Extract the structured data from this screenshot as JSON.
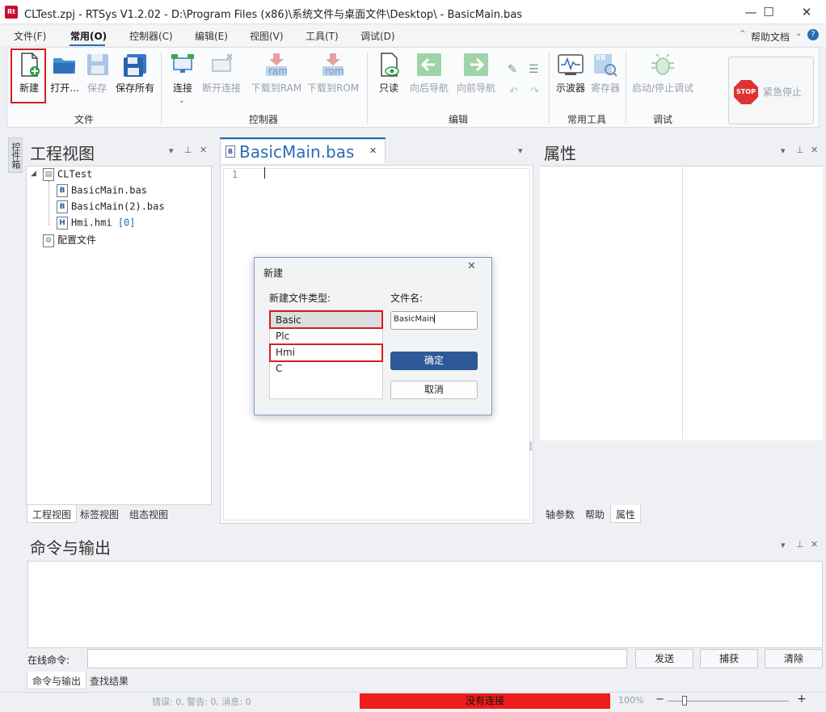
{
  "window": {
    "title": "CLTest.zpj - RTSys V1.2.02 - D:\\Program Files (x86)\\系统文件与桌面文件\\Desktop\\ - BasicMain.bas",
    "app_icon_text": "Rt",
    "minimize": "—",
    "maximize": "☐",
    "close": "✕"
  },
  "menu": {
    "items": [
      "文件(F)",
      "常用(O)",
      "控制器(C)",
      "编辑(E)",
      "视图(V)",
      "工具(T)",
      "调试(D)"
    ],
    "help_label": "帮助文档"
  },
  "ribbon": {
    "groups": [
      "文件",
      "控制器",
      "编辑",
      "常用工具",
      "调试"
    ],
    "buttons": {
      "new": "新建",
      "open": "打开...",
      "save": "保存",
      "save_all": "保存所有",
      "connect": "连接",
      "disconnect": "断开连接",
      "download_ram": "下载到RAM",
      "download_rom": "下载到ROM",
      "readonly": "只读",
      "nav_back": "向后导航",
      "nav_forward": "向前导航",
      "oscilloscope": "示波器",
      "register": "寄存器",
      "start_stop_debug": "启动/停止调试",
      "emergency_stop": "紧急停止"
    },
    "icon_texts": {
      "ram": "ram",
      "rom": "rom",
      "stop": "STOP",
      "vr": "VR"
    }
  },
  "side_tab": "控件箱",
  "project_panel": {
    "title": "工程视图",
    "tree": {
      "root": "CLTest",
      "files": [
        "BasicMain.bas",
        "BasicMain(2).bas",
        "Hmi.hmi"
      ],
      "hmi_badge": "[0]",
      "config": "配置文件"
    },
    "tabs": [
      "工程视图",
      "标签视图",
      "组态视图"
    ]
  },
  "editor": {
    "tab_label": "BasicMain.bas",
    "tab_icon_letter": "B",
    "line_number": "1"
  },
  "properties_panel": {
    "title": "属性",
    "tabs": [
      "轴参数",
      "帮助",
      "属性"
    ]
  },
  "command_panel": {
    "title": "命令与输出",
    "online_label": "在线命令:",
    "buttons": [
      "发送",
      "捕获",
      "清除"
    ],
    "tabs": [
      "命令与输出",
      "查找结果"
    ]
  },
  "status": {
    "messages": "错误: 0, 警告: 0, 消息: 0",
    "connection": "没有连接",
    "zoom": "100%",
    "zoom_minus": "−",
    "zoom_plus": "+"
  },
  "dialog": {
    "title": "新建",
    "type_label": "新建文件类型:",
    "filename_label": "文件名:",
    "types": [
      "Basic",
      "Plc",
      "Hmi",
      "C"
    ],
    "filename_value": "BasicMain",
    "ok": "确定",
    "cancel": "取消"
  },
  "colors": {
    "accent": "#2a6bb5",
    "highlight_red": "#d02020",
    "no_connection": "#ee1c1c",
    "dialog_ok": "#2d5a96"
  }
}
